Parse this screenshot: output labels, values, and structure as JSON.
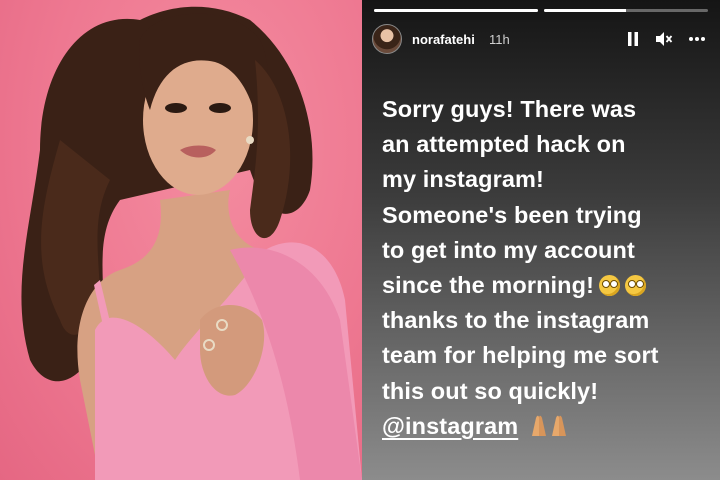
{
  "story": {
    "progress": [
      1.0,
      0.5
    ],
    "username": "norafatehi",
    "time_ago": "11h",
    "controls": {
      "pause_icon": "pause-icon",
      "mute_icon": "speaker-muted-icon",
      "more_icon": "more-horizontal-icon"
    },
    "caption_lines": [
      "Sorry guys! There was",
      "an attempted hack on",
      "my instagram!",
      "Someone's been trying",
      "to get into my account",
      "since the morning!",
      "thanks to the instagram",
      "team for helping me sort",
      "this out so quickly!"
    ],
    "emojis": [
      "flushed-face",
      "face-with-rolling-eyes"
    ],
    "mention": "@instagram",
    "hands_emoji": "folded-hands"
  },
  "colors": {
    "photo_background": "#ee7891",
    "outfit": "#f29ab8",
    "story_text": "#ffffff"
  }
}
